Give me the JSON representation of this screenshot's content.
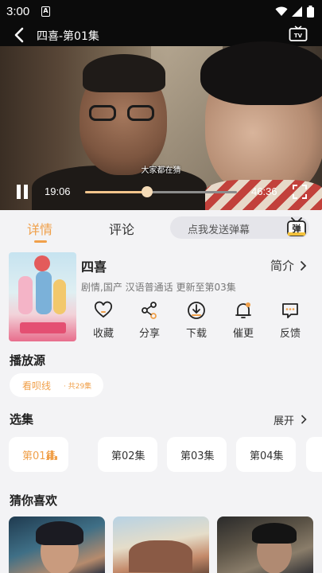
{
  "status_bar": {
    "time": "3:00",
    "app_icon_letter": "A"
  },
  "player": {
    "title": "四喜-第01集",
    "subtitle": "大家都在猜",
    "current_time": "19:06",
    "total_time": "46:36",
    "progress_fraction": 0.41
  },
  "tabs": [
    {
      "label": "详情",
      "active": true
    },
    {
      "label": "评论",
      "active": false
    }
  ],
  "danmu": {
    "placeholder": "点我发送弹幕",
    "icon_text": "弹"
  },
  "show": {
    "title": "四喜",
    "intro_label": "简介",
    "meta": "剧情,国产 汉语普通话 更新至第03集"
  },
  "actions": [
    {
      "label": "收藏",
      "icon": "heart-icon"
    },
    {
      "label": "分享",
      "icon": "share-icon"
    },
    {
      "label": "下载",
      "icon": "download-icon"
    },
    {
      "label": "催更",
      "icon": "bell-icon"
    },
    {
      "label": "反馈",
      "icon": "feedback-icon"
    }
  ],
  "source": {
    "section_title": "播放源",
    "name": "看呗线",
    "count": "· 共29集"
  },
  "episodes": {
    "section_title": "选集",
    "expand_label": "展开",
    "items": [
      {
        "label": "第01集",
        "active": true
      },
      {
        "label": "第02集",
        "active": false
      },
      {
        "label": "第03集",
        "active": false
      },
      {
        "label": "第04集",
        "active": false
      }
    ]
  },
  "recommend": {
    "section_title": "猜你喜欢"
  },
  "colors": {
    "accent": "#f0a04a",
    "seek_fill": "#f2c58c",
    "panel_bg": "#f3f3f5"
  }
}
